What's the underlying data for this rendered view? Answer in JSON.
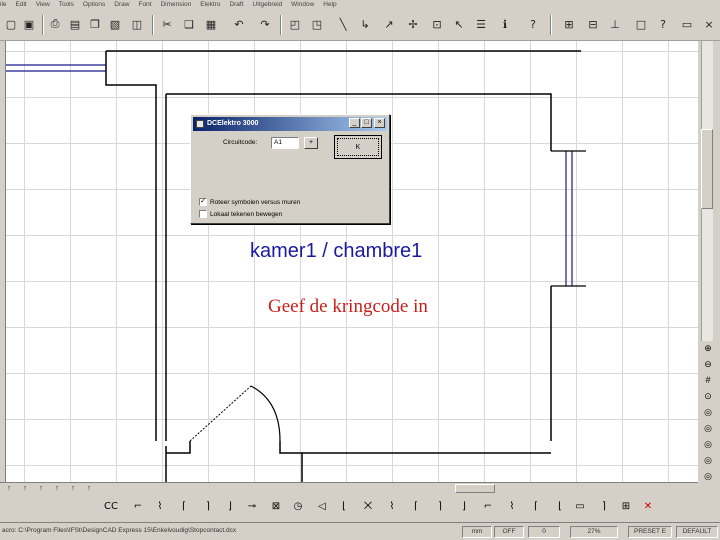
{
  "menubar": {
    "items": [
      "ile",
      "Edit",
      "View",
      "Tools",
      "Options",
      "Draw",
      "Font",
      "Dimension",
      "Elektro",
      "Draft",
      "Uitgebreid",
      "Window",
      "Help"
    ]
  },
  "toolbar_top": {
    "icons": [
      "new-file-icon",
      "save-icon",
      "print-icon",
      "print-preview-icon",
      "copy-icon",
      "export-icon",
      "cut-icon",
      "copy-icon",
      "paste-icon",
      "undo-icon",
      "redo-icon",
      "properties-icon",
      "properties-icon",
      "line-icon",
      "corner-icon",
      "arrow-icon",
      "node-icon",
      "select-icon",
      "list-icon",
      "info-icon",
      "help-icon",
      "zoom-fit-icon",
      "mirror-icon",
      "measure-icon",
      "rectangle-icon",
      "question-icon",
      "window-icon",
      "maximize-icon",
      "close-icon"
    ]
  },
  "dialog": {
    "title": "DCElektro 3000",
    "minimize": "_",
    "maximize": "□",
    "close": "×",
    "circuit_label": "Circuitcode:",
    "circuit_value": "A1",
    "plus_label": "+",
    "ok_label": "K",
    "check1_label": "Roteer symbolen versus muren",
    "check1_checked": true,
    "check2_label": "Lokaal tekenen bewegen",
    "check2_checked": false
  },
  "canvas": {
    "room_label": "kamer1 / chambre1",
    "prompt": "Geef de kringcode in"
  },
  "statusbar": {
    "path": "acro: C:\\Program Files\\IFSt\\DesignCAD Express 15\\Enkelvoudig\\Stopcontact.dcx",
    "cells": [
      "mm",
      "OFF",
      "0",
      "27%",
      "PRESET E",
      "DEFAULT"
    ]
  },
  "colors": {
    "room_label": "#1a1aa0",
    "prompt": "#c8201c",
    "title_bar": "#0a246a"
  }
}
